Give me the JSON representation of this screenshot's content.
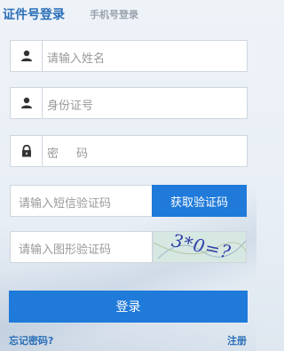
{
  "tabs": {
    "cert": "证件号登录",
    "phone": "手机号登录"
  },
  "form": {
    "name_placeholder": "请输入姓名",
    "id_placeholder": "身份证号",
    "password_placeholder": "密码",
    "sms_placeholder": "请输入短信验证码",
    "sms_button": "获取验证码",
    "captcha_placeholder": "请输入图形验证码",
    "captcha_text": "3*0=?"
  },
  "actions": {
    "login": "登录",
    "forgot": "忘记密码?",
    "register": "注册"
  },
  "icons": {
    "name": "user-icon",
    "id": "user-icon",
    "password": "lock-icon"
  },
  "colors": {
    "accent": "#1f7ad9",
    "tab_active": "#2a6fb8",
    "tab_inactive": "#9aa3ad"
  }
}
